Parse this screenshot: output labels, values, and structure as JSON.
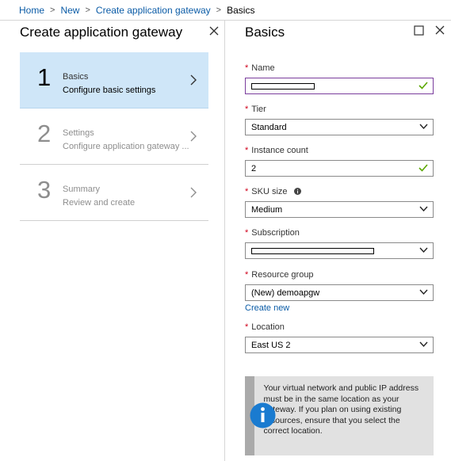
{
  "breadcrumb": {
    "items": [
      "Home",
      "New",
      "Create application gateway"
    ],
    "current": "Basics"
  },
  "left_blade": {
    "title": "Create application gateway",
    "steps": [
      {
        "number": "1",
        "title": "Basics",
        "subtitle": "Configure basic settings",
        "state": "active"
      },
      {
        "number": "2",
        "title": "Settings",
        "subtitle": "Configure application gateway ...",
        "state": "inactive"
      },
      {
        "number": "3",
        "title": "Summary",
        "subtitle": "Review and create",
        "state": "inactive"
      }
    ]
  },
  "right_blade": {
    "title": "Basics",
    "fields": {
      "name": {
        "label": "Name",
        "value": "",
        "redacted": true,
        "valid": true
      },
      "tier": {
        "label": "Tier",
        "value": "Standard"
      },
      "instance_count": {
        "label": "Instance count",
        "value": "2",
        "valid": true
      },
      "sku_size": {
        "label": "SKU size",
        "value": "Medium"
      },
      "subscription": {
        "label": "Subscription",
        "value": "",
        "redacted": true
      },
      "resource_group": {
        "label": "Resource group",
        "value": "(New) demoapgw",
        "link": "Create new"
      },
      "location": {
        "label": "Location",
        "value": "East US 2"
      }
    },
    "info_text": "Your virtual network and public IP address must be in the same location as your gateway. If you plan on using existing resources, ensure that you select the correct location."
  },
  "colors": {
    "link": "#0a5ba6",
    "required": "#d0021b",
    "active_step": "#cfe6f8",
    "valid_check": "#5aa700",
    "focus_border": "#7a3d9d",
    "info_icon": "#1a7bd0"
  }
}
